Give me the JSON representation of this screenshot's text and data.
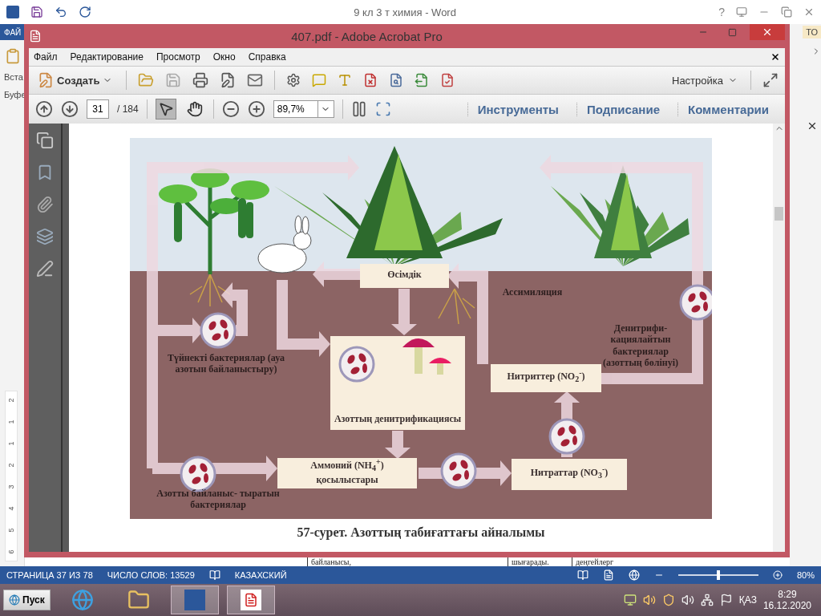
{
  "word": {
    "title": "9 кл 3 т химия - Word",
    "help": "?",
    "file_tab": "ФАЙ",
    "right_tab": "ТО",
    "left_labels": [
      "Вста",
      "Буфе"
    ],
    "ruler_numbers": [
      "2",
      "1",
      "1",
      "2",
      "3",
      "4",
      "5",
      "6"
    ],
    "table_fragments": [
      "байланысы,",
      "шығарады.",
      "деңгейлерг"
    ],
    "status": {
      "page": "СТРАНИЦА 37 ИЗ 78",
      "words": "ЧИСЛО СЛОВ: 13529",
      "language": "КАЗАХСКИЙ",
      "zoom": "80%",
      "zoom_slider": {
        "level": 0.5
      }
    }
  },
  "acrobat": {
    "title": "407.pdf - Adobe Acrobat Pro",
    "menu": [
      "Файл",
      "Редактирование",
      "Просмотр",
      "Окно",
      "Справка"
    ],
    "create": "Создать",
    "customize": "Настройка",
    "page": "31",
    "page_total": "/ 184",
    "zoom": "89,7%",
    "tools": [
      {
        "kind": "select",
        "selected": true
      },
      {
        "kind": "hand",
        "selected": false
      }
    ],
    "panels": [
      "Инструменты",
      "Подписание",
      "Комментарии"
    ],
    "diagram": {
      "boxes": [
        {
          "text": "Өсімдік"
        },
        {
          "text": "Азоттың денитрификациясы"
        },
        {
          "text": "Аммоний (NH$_{4}$$^{+}$) қосылыстары"
        },
        {
          "text": "Нитраттар (NO$_{3}$$^{-}$)"
        },
        {
          "text": "Нитриттер (NO$_{2}$$^{-}$)"
        }
      ],
      "labels": [
        "Ассимиляция",
        "Денитрифи- кациялайтын бактериялар (азоттың бөлінуі)",
        "Түйнекті бактериялар (ауа азотын байланыстыру)",
        "Азотты байланыс- тыратын бактериялар"
      ],
      "caption": "57-сурет. Азоттың табиғаттағы айналымы"
    }
  },
  "taskbar": {
    "start": "Пуск",
    "language": "ҚАЗ",
    "time": "8:29",
    "date": "16.12.2020"
  }
}
